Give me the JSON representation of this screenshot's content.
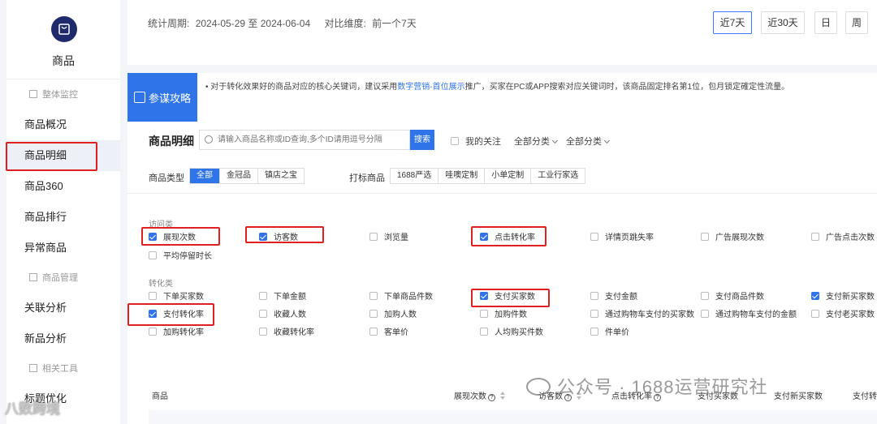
{
  "sidebar": {
    "logo_label": "商品",
    "groups": {
      "monitor": "整体监控",
      "manage": "商品管理",
      "tools": "相关工具"
    },
    "items": {
      "overview": "商品概况",
      "detail": "商品明细",
      "p360": "商品360",
      "rank": "商品排行",
      "abnormal": "异常商品",
      "related": "关联分析",
      "newp": "新品分析",
      "title_opt": "标题优化"
    }
  },
  "topbar": {
    "period_label": "统计周期:",
    "period_value": "2024-05-29 至 2024-06-04",
    "compare_label": "对比维度:",
    "compare_value": "前一个7天",
    "ranges": [
      "近7天",
      "近30天",
      "日",
      "周"
    ]
  },
  "tip": {
    "badge": "参谋攻略",
    "text_before": "• 对于转化效果好的商品对应的核心关键词，建议采用",
    "link": "数字营销-首位展示",
    "text_after": "推广，买家在PC或APP搜索对应关键词时，该商品固定排名第1位，包月锁定確定性流量。"
  },
  "main": {
    "title": "商品明细",
    "search_placeholder": "请输入商品名称或ID查询,多个ID请用逗号分隔",
    "search_button": "搜索",
    "my_follow": "我的关注",
    "dropdown1": "全部分类",
    "dropdown2": "全部分类",
    "type_label": "商品类型",
    "types": [
      "全部",
      "金冠品",
      "镇店之宝"
    ],
    "mark_label": "打标商品",
    "marks": [
      "1688严选",
      "哇噢定制",
      "小单定制",
      "工业行家选"
    ]
  },
  "metrics": {
    "visit_label": "访问类",
    "visit": [
      {
        "label": "展现次数",
        "checked": true
      },
      {
        "label": "访客数",
        "checked": true
      },
      {
        "label": "浏览量",
        "checked": false
      },
      {
        "label": "点击转化率",
        "checked": true
      },
      {
        "label": "详情页跳失率",
        "checked": false
      },
      {
        "label": "广告展现次数",
        "checked": false
      },
      {
        "label": "广告点击次数",
        "checked": false
      },
      {
        "label": "平均停留时长",
        "checked": false
      }
    ],
    "conv_label": "转化类",
    "conv": [
      {
        "label": "下单买家数",
        "checked": false
      },
      {
        "label": "下单金额",
        "checked": false
      },
      {
        "label": "下单商品件数",
        "checked": false
      },
      {
        "label": "支付买家数",
        "checked": true
      },
      {
        "label": "支付金额",
        "checked": false
      },
      {
        "label": "支付商品件数",
        "checked": false
      },
      {
        "label": "支付新买家数",
        "checked": true
      },
      {
        "label": "支付转化率",
        "checked": true
      },
      {
        "label": "收藏人数",
        "checked": false
      },
      {
        "label": "加购人数",
        "checked": false
      },
      {
        "label": "加购件数",
        "checked": false
      },
      {
        "label": "通过购物车支付的买家数",
        "checked": false
      },
      {
        "label": "通过购物车支付的金额",
        "checked": false
      },
      {
        "label": "支付老买家数",
        "checked": false
      },
      {
        "label": "加购转化率",
        "checked": false
      },
      {
        "label": "收藏转化率",
        "checked": false
      },
      {
        "label": "客单价",
        "checked": false
      },
      {
        "label": "人均购买件数",
        "checked": false
      },
      {
        "label": "件单价",
        "checked": false
      }
    ]
  },
  "table": {
    "headers": {
      "product": "商品",
      "impressions": "展现次数",
      "visitors": "访客数",
      "click_conv": "点击转化率",
      "pay_buyers": "支付买家数",
      "pay_new_buyers": "支付新买家数",
      "pay_conv": "支付转"
    }
  },
  "watermarks": {
    "wechat": "公众号 · 1688运营研究社",
    "corner": "八数跨境"
  },
  "colors": {
    "accent": "#2f74e8",
    "highlight": "#e02020",
    "logo_bg": "#1f2a6b"
  }
}
